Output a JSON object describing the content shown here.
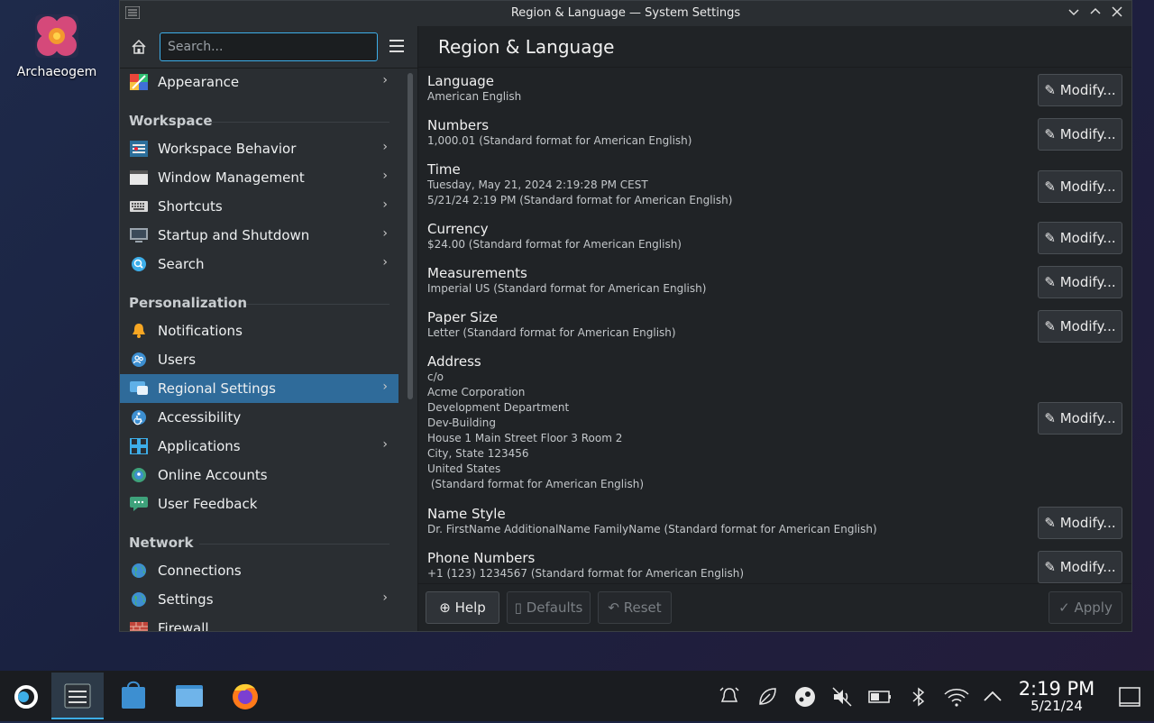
{
  "desktop": {
    "icon_label": "Archaeogem"
  },
  "window": {
    "title": "Region & Language — System Settings"
  },
  "sidebar": {
    "search_placeholder": "Search...",
    "top_item": "Appearance",
    "sections": [
      {
        "title": "Workspace",
        "items": [
          "Workspace Behavior",
          "Window Management",
          "Shortcuts",
          "Startup and Shutdown",
          "Search"
        ]
      },
      {
        "title": "Personalization",
        "items": [
          "Notifications",
          "Users",
          "Regional Settings",
          "Accessibility",
          "Applications",
          "Online Accounts",
          "User Feedback"
        ]
      },
      {
        "title": "Network",
        "items": [
          "Connections",
          "Settings",
          "Firewall"
        ]
      }
    ]
  },
  "main": {
    "title": "Region & Language",
    "modify_label": "Modify...",
    "rows": [
      {
        "name": "Language",
        "values": [
          "American English"
        ]
      },
      {
        "name": "Numbers",
        "values": [
          "1,000.01 (Standard format for American English)"
        ]
      },
      {
        "name": "Time",
        "values": [
          "Tuesday, May 21, 2024 2:19:28 PM CEST",
          "5/21/24 2:19 PM (Standard format for American English)"
        ]
      },
      {
        "name": "Currency",
        "values": [
          "$24.00 (Standard format for American English)"
        ]
      },
      {
        "name": "Measurements",
        "values": [
          "Imperial US (Standard format for American English)"
        ]
      },
      {
        "name": "Paper Size",
        "values": [
          "Letter (Standard format for American English)"
        ]
      },
      {
        "name": "Address",
        "values": [
          "c/o",
          "Acme Corporation",
          "Development Department",
          "Dev-Building",
          "House 1 Main Street Floor 3 Room 2",
          "City, State 123456",
          "United States",
          " (Standard format for American English)"
        ]
      },
      {
        "name": "Name Style",
        "values": [
          "Dr. FirstName AdditionalName FamilyName (Standard format for American English)"
        ]
      },
      {
        "name": "Phone Numbers",
        "values": [
          "+1 (123) 1234567 (Standard format for American English)"
        ]
      }
    ]
  },
  "footer": {
    "help": "Help",
    "defaults": "Defaults",
    "reset": "Reset",
    "apply": "Apply"
  },
  "taskbar": {
    "time": "2:19 PM",
    "date": "5/21/24"
  },
  "colors": {
    "accent": "#3daee9",
    "selected": "#2f6b9a",
    "window_bg": "#202326",
    "sidebar_bg": "#2a2e32"
  }
}
